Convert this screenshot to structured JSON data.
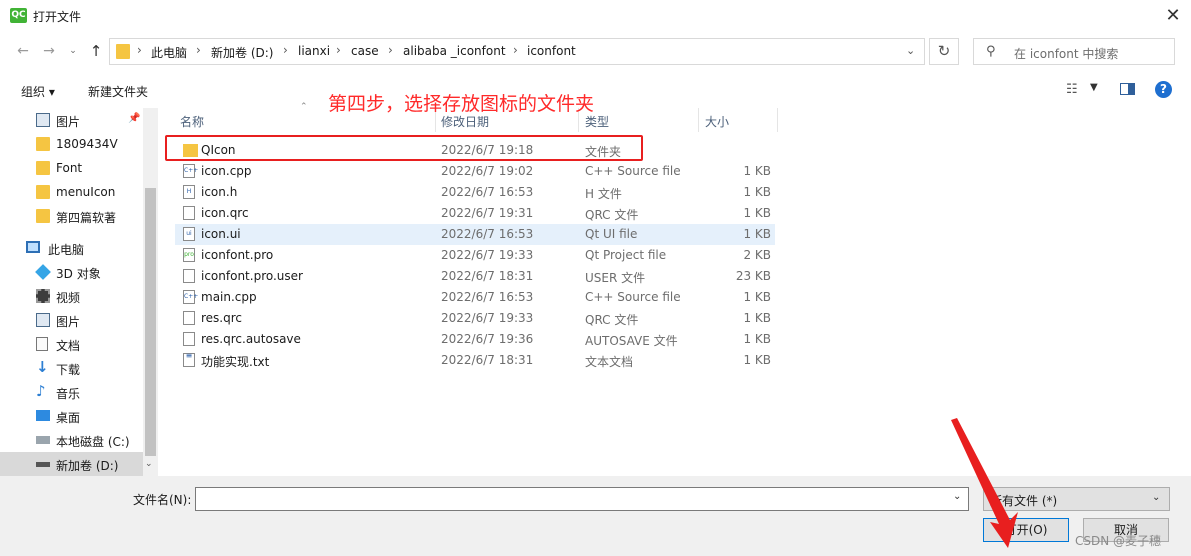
{
  "window": {
    "title": "打开文件",
    "app_icon_text": "QC"
  },
  "address": {
    "crumbs": [
      "此电脑",
      "新加卷 (D:)",
      "lianxi",
      "case",
      "alibaba _iconfont",
      "iconfont"
    ]
  },
  "search": {
    "placeholder": "在 iconfont 中搜索"
  },
  "toolbar": {
    "organize": "组织 ▾",
    "new_folder": "新建文件夹"
  },
  "navpane": {
    "items": [
      {
        "label": "图片",
        "icon": "pictures-icon"
      },
      {
        "label": "1809434V",
        "icon": "folder-icon"
      },
      {
        "label": "Font",
        "icon": "folder-icon"
      },
      {
        "label": "menuIcon",
        "icon": "folder-icon"
      },
      {
        "label": "第四篇软著",
        "icon": "folder-icon"
      },
      {
        "label": "此电脑",
        "icon": "computer-icon"
      },
      {
        "label": "3D 对象",
        "icon": "3d-objects-icon"
      },
      {
        "label": "视频",
        "icon": "video-icon"
      },
      {
        "label": "图片",
        "icon": "pictures-icon"
      },
      {
        "label": "文档",
        "icon": "documents-icon"
      },
      {
        "label": "下载",
        "icon": "download-icon"
      },
      {
        "label": "音乐",
        "icon": "music-icon"
      },
      {
        "label": "桌面",
        "icon": "desktop-icon"
      },
      {
        "label": "本地磁盘 (C:)",
        "icon": "drive-icon"
      },
      {
        "label": "新加卷 (D:)",
        "icon": "drive-icon"
      }
    ]
  },
  "filelist": {
    "columns": {
      "name": "名称",
      "date": "修改日期",
      "type": "类型",
      "size": "大小"
    },
    "rows": [
      {
        "name": "QIcon",
        "date": "2022/6/7 19:18",
        "type": "文件夹",
        "size": ""
      },
      {
        "name": "icon.cpp",
        "date": "2022/6/7 19:02",
        "type": "C++ Source file",
        "size": "1 KB"
      },
      {
        "name": "icon.h",
        "date": "2022/6/7 16:53",
        "type": "H 文件",
        "size": "1 KB"
      },
      {
        "name": "icon.qrc",
        "date": "2022/6/7 19:31",
        "type": "QRC 文件",
        "size": "1 KB"
      },
      {
        "name": "icon.ui",
        "date": "2022/6/7 16:53",
        "type": "Qt UI file",
        "size": "1 KB"
      },
      {
        "name": "iconfont.pro",
        "date": "2022/6/7 19:33",
        "type": "Qt Project file",
        "size": "2 KB"
      },
      {
        "name": "iconfont.pro.user",
        "date": "2022/6/7 18:31",
        "type": "USER 文件",
        "size": "23 KB"
      },
      {
        "name": "main.cpp",
        "date": "2022/6/7 16:53",
        "type": "C++ Source file",
        "size": "1 KB"
      },
      {
        "name": "res.qrc",
        "date": "2022/6/7 19:33",
        "type": "QRC 文件",
        "size": "1 KB"
      },
      {
        "name": "res.qrc.autosave",
        "date": "2022/6/7 19:36",
        "type": "AUTOSAVE 文件",
        "size": "1 KB"
      },
      {
        "name": "功能实现.txt",
        "date": "2022/6/7 18:31",
        "type": "文本文档",
        "size": "1 KB"
      }
    ]
  },
  "annotation": {
    "text": "第四步，选择存放图标的文件夹"
  },
  "bottom": {
    "filename_label": "文件名(N):",
    "filename_value": "",
    "filetype_value": "所有文件  (*)",
    "open_label": "打开(O)",
    "cancel_label": "取消"
  },
  "watermark": "CSDN @麦子穗"
}
